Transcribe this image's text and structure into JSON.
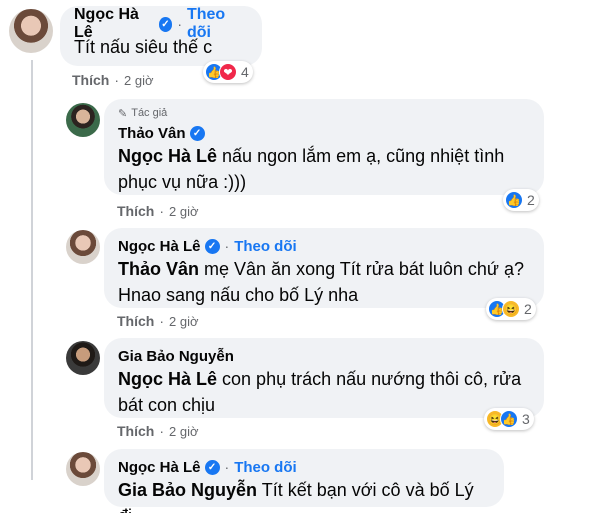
{
  "comments": [
    {
      "author": "Ngọc Hà Lê",
      "follow": "Theo dõi",
      "text": "Tít nấu siêu thế c",
      "like": "Thích",
      "time": "2 giờ",
      "reactions": [
        "like-icon",
        "love-icon"
      ],
      "reaction_count": "4"
    },
    {
      "author_badge": "Tác giả",
      "author": "Thảo Vân",
      "mention": "Ngọc Hà Lê",
      "text_line1": " nấu ngon lắm em ạ, cũng nhiệt tình",
      "text_line2": "phục vụ nữa :)))",
      "like": "Thích",
      "time": "2 giờ",
      "reactions": [
        "like-icon"
      ],
      "reaction_count": "2"
    },
    {
      "author": "Ngọc Hà Lê",
      "follow": "Theo dõi",
      "mention": "Thảo Vân",
      "text_line1": " mẹ Vân ăn xong Tít rửa bát luôn chứ ạ?",
      "text_line2": "Hnao sang nấu cho bố Lý nha",
      "like": "Thích",
      "time": "2 giờ",
      "reactions": [
        "like-icon",
        "haha-icon"
      ],
      "reaction_count": "2"
    },
    {
      "author": "Gia Bảo Nguyễn",
      "mention": "Ngọc Hà Lê",
      "text_line1": " con phụ trách nấu nướng thôi cô, rửa",
      "text_line2": "bát con chịu",
      "like": "Thích",
      "time": "2 giờ",
      "reactions": [
        "haha-icon",
        "like-icon"
      ],
      "reaction_count": "3"
    },
    {
      "author": "Ngọc Hà Lê",
      "follow": "Theo dõi",
      "mention": "Gia Bảo Nguyễn",
      "text_line1": " Tít kết bạn với cô và bố Lý đi"
    }
  ],
  "glyphs": {
    "verified": "✓",
    "dot": "·",
    "like": "👍",
    "love": "❤",
    "haha": "😆",
    "pen": "✎"
  },
  "colors": {
    "accent": "#1877f2",
    "bubble": "#f0f2f5",
    "meta": "#65676b"
  }
}
